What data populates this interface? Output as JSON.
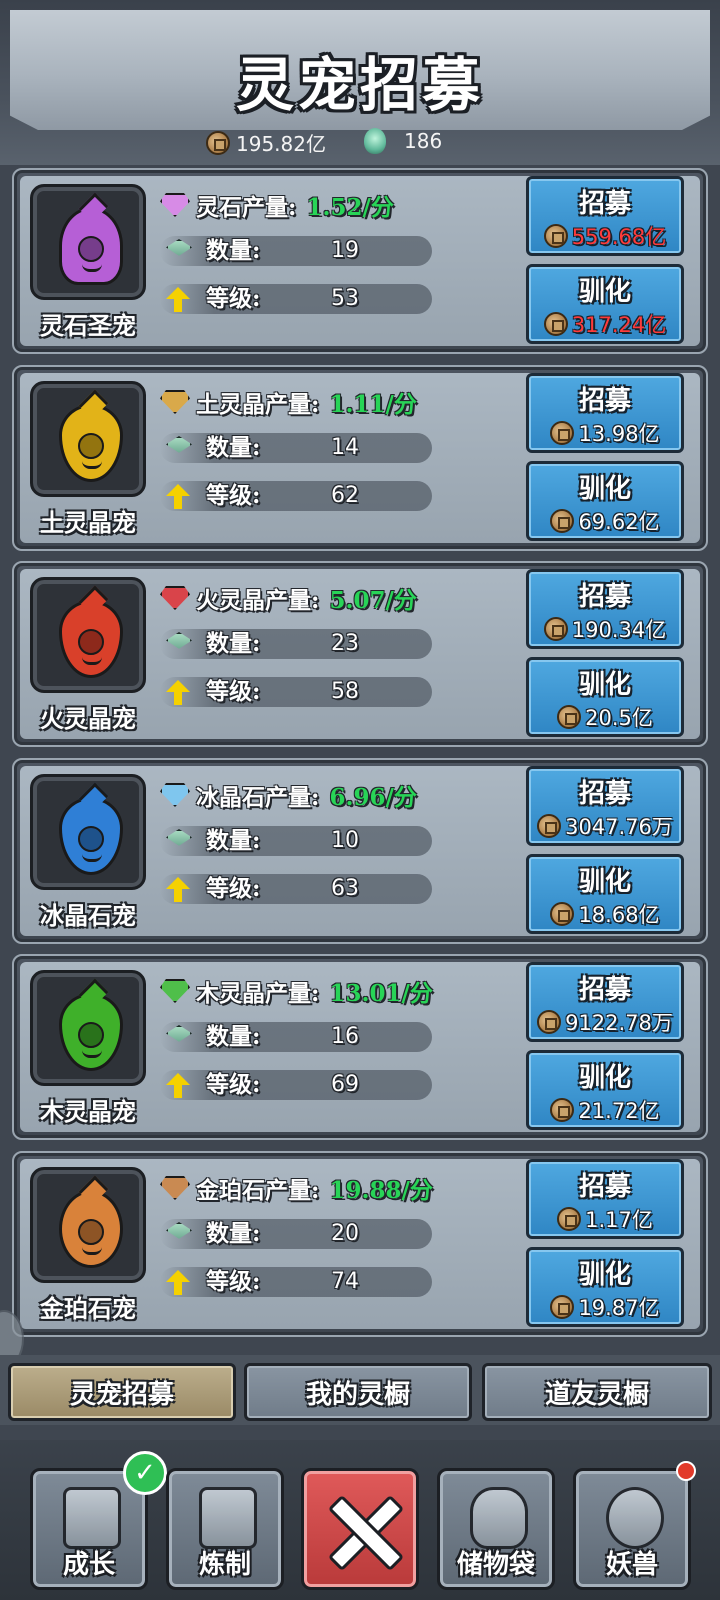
{
  "header": {
    "title": "灵宠招募",
    "coins": "195.82亿",
    "soul_count": "186"
  },
  "pets": [
    {
      "name": "灵石圣宠",
      "production_label": "灵石产量:",
      "production_value": "1.52/分",
      "count_label": "数量:",
      "count": "19",
      "level_label": "等级:",
      "level": "53",
      "recruit_label": "招募",
      "recruit_cost": "559.68亿",
      "recruit_cost_insufficient": true,
      "tame_label": "驯化",
      "tame_cost": "317.24亿",
      "tame_cost_insufficient": true,
      "gem_color": "#d78be6",
      "pet_color": "#b65fd6"
    },
    {
      "name": "土灵晶宠",
      "production_label": "土灵晶产量:",
      "production_value": "1.11/分",
      "count_label": "数量:",
      "count": "14",
      "level_label": "等级:",
      "level": "62",
      "recruit_label": "招募",
      "recruit_cost": "13.98亿",
      "recruit_cost_insufficient": false,
      "tame_label": "驯化",
      "tame_cost": "69.62亿",
      "tame_cost_insufficient": false,
      "gem_color": "#d9a94a",
      "pet_color": "#e2b318"
    },
    {
      "name": "火灵晶宠",
      "production_label": "火灵晶产量:",
      "production_value": "5.07/分",
      "count_label": "数量:",
      "count": "23",
      "level_label": "等级:",
      "level": "58",
      "recruit_label": "招募",
      "recruit_cost": "190.34亿",
      "recruit_cost_insufficient": false,
      "tame_label": "驯化",
      "tame_cost": "20.5亿",
      "tame_cost_insufficient": false,
      "gem_color": "#d9444a",
      "pet_color": "#d9402a"
    },
    {
      "name": "冰晶石宠",
      "production_label": "冰晶石产量:",
      "production_value": "6.96/分",
      "count_label": "数量:",
      "count": "10",
      "level_label": "等级:",
      "level": "63",
      "recruit_label": "招募",
      "recruit_cost": "3047.76万",
      "recruit_cost_insufficient": false,
      "tame_label": "驯化",
      "tame_cost": "18.68亿",
      "tame_cost_insufficient": false,
      "gem_color": "#7fc6ee",
      "pet_color": "#2f7fd6"
    },
    {
      "name": "木灵晶宠",
      "production_label": "木灵晶产量:",
      "production_value": "13.01/分",
      "count_label": "数量:",
      "count": "16",
      "level_label": "等级:",
      "level": "69",
      "recruit_label": "招募",
      "recruit_cost": "9122.78万",
      "recruit_cost_insufficient": false,
      "tame_label": "驯化",
      "tame_cost": "21.72亿",
      "tame_cost_insufficient": false,
      "gem_color": "#4fbf4a",
      "pet_color": "#3fb02a"
    },
    {
      "name": "金珀石宠",
      "production_label": "金珀石产量:",
      "production_value": "19.88/分",
      "count_label": "数量:",
      "count": "20",
      "level_label": "等级:",
      "level": "74",
      "recruit_label": "招募",
      "recruit_cost": "1.17亿",
      "recruit_cost_insufficient": false,
      "tame_label": "驯化",
      "tame_cost": "19.87亿",
      "tame_cost_insufficient": false,
      "gem_color": "#c98a52",
      "pet_color": "#d9823a"
    }
  ],
  "tabs": [
    {
      "label": "灵宠招募",
      "active": true
    },
    {
      "label": "我的灵橱",
      "active": false
    },
    {
      "label": "道友灵橱",
      "active": false
    }
  ],
  "bottom_nav": [
    {
      "label": "成长",
      "icon": "growth-icon",
      "badge": "check"
    },
    {
      "label": "炼制",
      "icon": "anvil-icon",
      "badge": null
    },
    {
      "label": "",
      "icon": "close-icon",
      "badge": null
    },
    {
      "label": "储物袋",
      "icon": "bag-icon",
      "badge": null
    },
    {
      "label": "妖兽",
      "icon": "beast-icon",
      "badge": "red-dot"
    }
  ],
  "colors": {
    "production_green": "#28d457",
    "insufficient_red": "#ff3b3b",
    "button_blue": "#3f97d3"
  }
}
